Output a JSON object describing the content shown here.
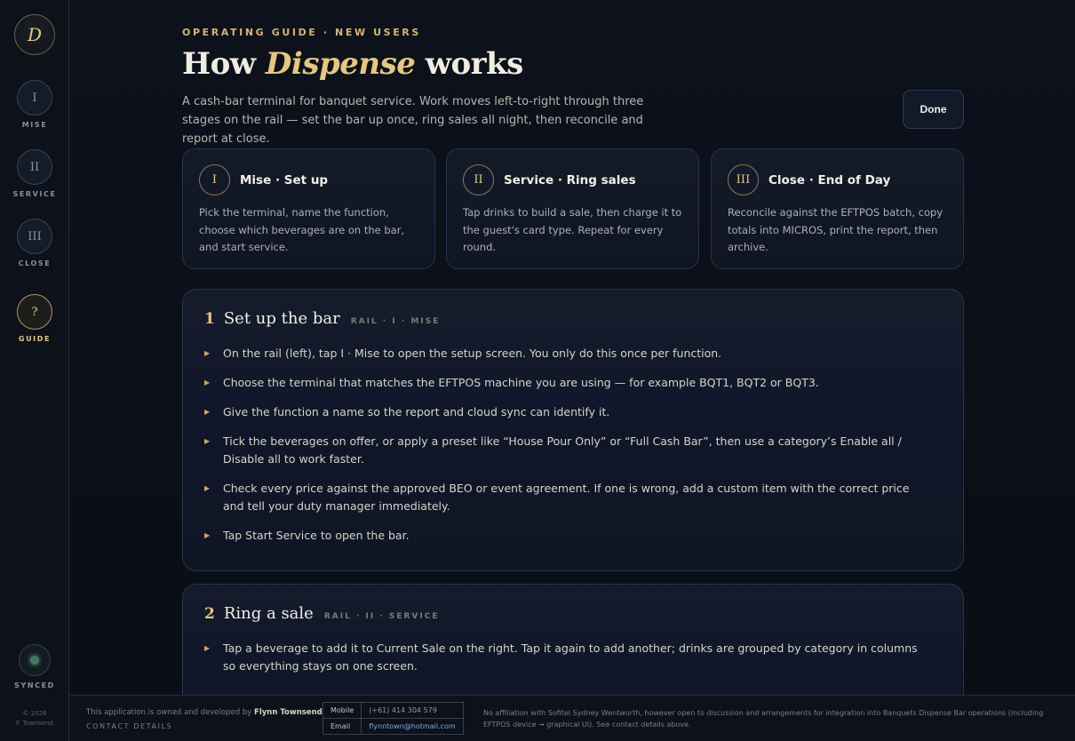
{
  "app": {
    "logo_letter": "D"
  },
  "rail": {
    "items": [
      {
        "numeral": "I",
        "label": "MISE"
      },
      {
        "numeral": "II",
        "label": "SERVICE"
      },
      {
        "numeral": "III",
        "label": "CLOSE"
      },
      {
        "numeral": "?",
        "label": "GUIDE"
      }
    ],
    "sync_label": "SYNCED",
    "copyright_line1": "© 2026",
    "copyright_line2": "F. Townsend"
  },
  "header": {
    "eyebrow": "OPERATING GUIDE · NEW USERS",
    "title_pre": "How",
    "title_em": "Dispense",
    "title_post": "works",
    "intro": "A cash-bar terminal for banquet service. Work moves left-to-right through three stages on the rail — set the bar up once, ring sales all night, then reconcile and report at close.",
    "done_label": "Done"
  },
  "stages": [
    {
      "numeral": "I",
      "title": "Mise · Set up",
      "desc": "Pick the terminal, name the function, choose which beverages are on the bar, and start service."
    },
    {
      "numeral": "II",
      "title": "Service · Ring sales",
      "desc": "Tap drinks to build a sale, then charge it to the guest's card type. Repeat for every round."
    },
    {
      "numeral": "III",
      "title": "Close · End of Day",
      "desc": "Reconcile against the EFTPOS batch, copy totals into MICROS, print the report, then archive."
    }
  ],
  "sections": [
    {
      "num": "1",
      "title": "Set up the bar",
      "tag": "RAIL · I · MISE",
      "bullets": [
        "On the rail (left), tap I · Mise to open the setup screen. You only do this once per function.",
        "Choose the terminal that matches the EFTPOS machine you are using — for example BQT1, BQT2 or BQT3.",
        "Give the function a name so the report and cloud sync can identify it.",
        "Tick the beverages on offer, or apply a preset like “House Pour Only” or “Full Cash Bar”, then use a category’s Enable all / Disable all to work faster.",
        "Check every price against the approved BEO or event agreement. If one is wrong, add a custom item with the correct price and tell your duty manager immediately.",
        "Tap Start Service to open the bar."
      ]
    },
    {
      "num": "2",
      "title": "Ring a sale",
      "tag": "RAIL · II · SERVICE",
      "bullets": [
        "Tap a beverage to add it to Current Sale on the right. Tap it again to add another; drinks are grouped by category in columns so everything stays on one screen."
      ]
    }
  ],
  "footer": {
    "owner_prefix": "This application is owned and developed by",
    "owner_name": "Flynn Townsend",
    "contact_label": "CONTACT DETAILS",
    "mobile_key": "Mobile",
    "mobile_value": "(+61) 414 304 579",
    "email_key": "Email",
    "email_value": "flynntown@hotmail.com",
    "disclaimer": "No affiliation with Sofitel Sydney Wentworth, however open to discussion and arrangements for integration into Banquets Dispense Bar operations (including EFTPOS device → graphical UI). See contact details above."
  },
  "colors": {
    "accent": "#e6c77e",
    "background": "#0a0e16",
    "card": "#131a29",
    "border": "#283349"
  }
}
